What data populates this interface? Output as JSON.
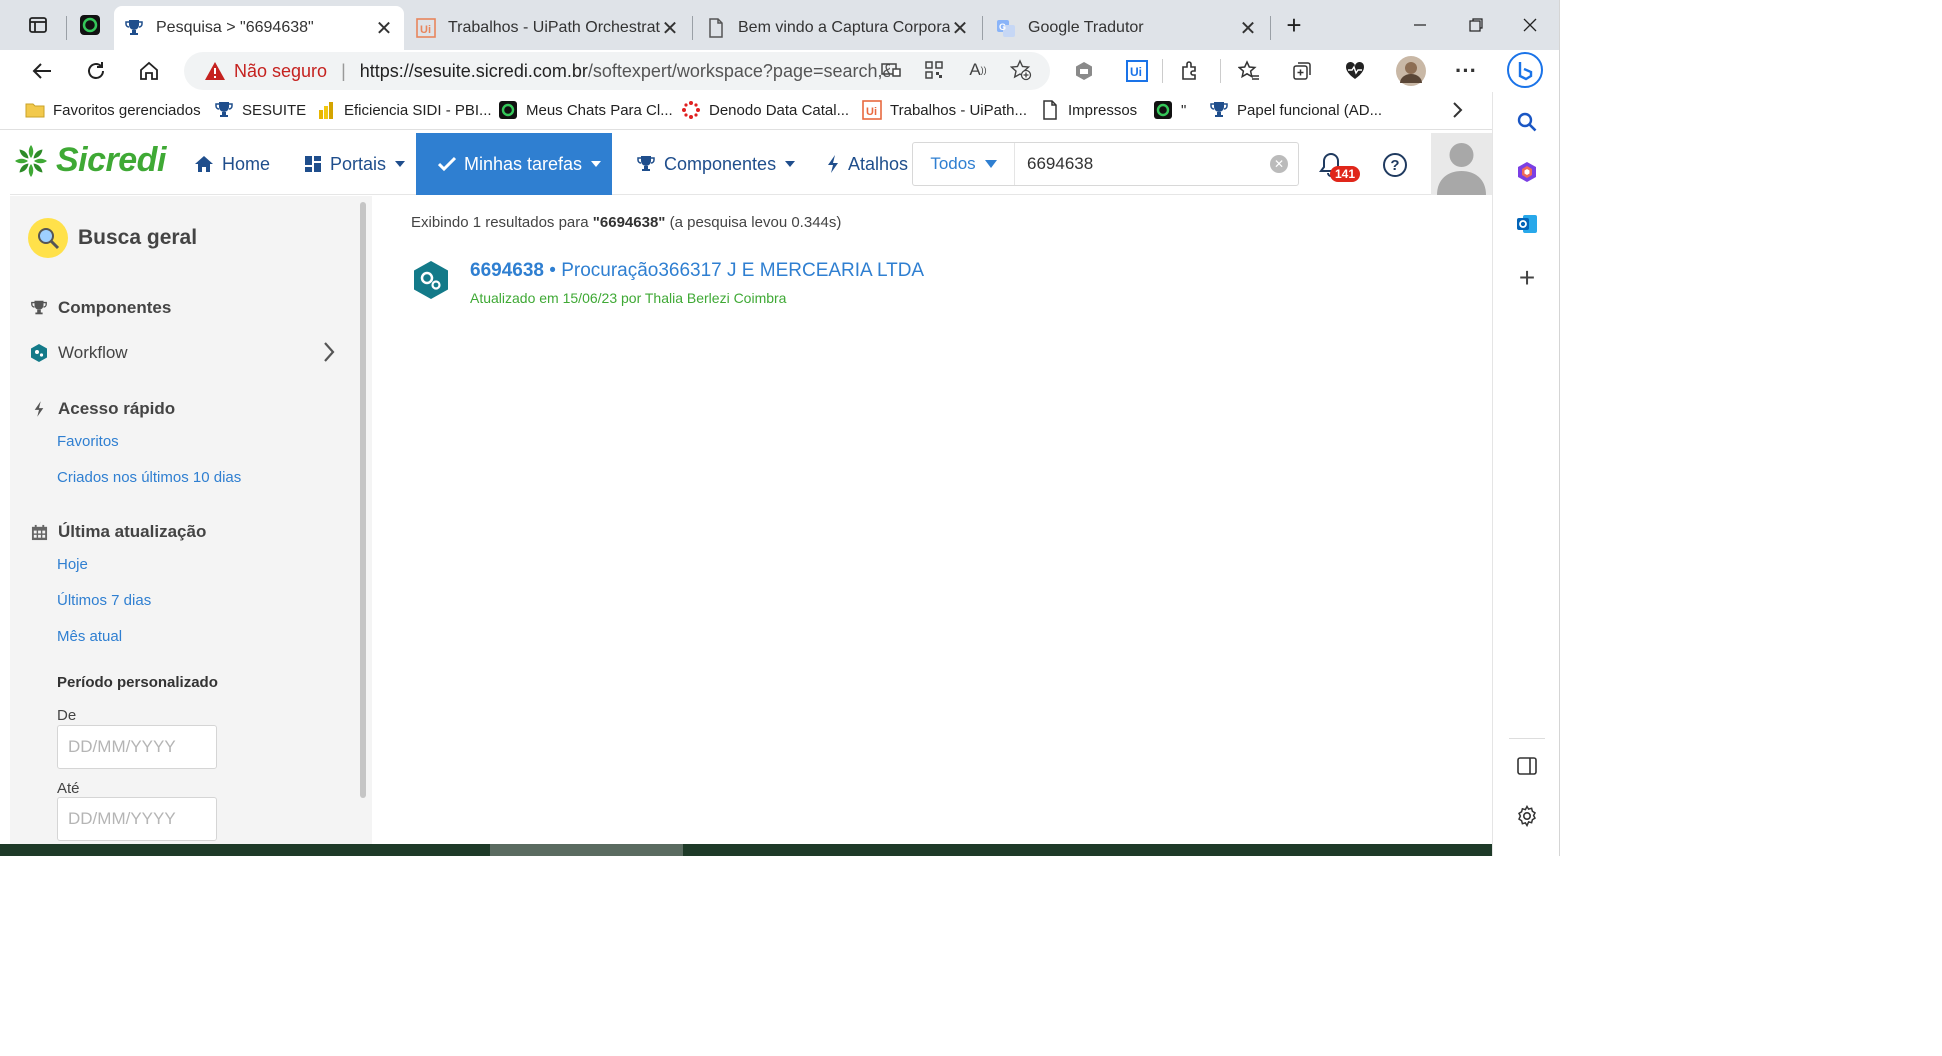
{
  "browser": {
    "tabs": [
      {
        "title": "Pesquisa > \"6694638\"",
        "icon": "trophy-icon",
        "active": true
      },
      {
        "title": "Trabalhos - UiPath Orchestrator",
        "icon": "uipath-icon",
        "active": false
      },
      {
        "title": "Bem vindo a Captura Corporativa",
        "icon": "page-icon",
        "active": false
      },
      {
        "title": "Google Tradutor",
        "icon": "google-translate-icon",
        "active": false
      }
    ],
    "address": {
      "security_label": "Não seguro",
      "url_host": "https://sesuite.sicredi.com.br",
      "url_path": "/softexpert/workspace?page=search,&..."
    },
    "bookmarks": [
      {
        "label": "Favoritos gerenciados",
        "icon": "folder-icon"
      },
      {
        "label": "SESUITE",
        "icon": "trophy-icon"
      },
      {
        "label": "Eficiencia SIDI - PBI...",
        "icon": "powerbi-icon"
      },
      {
        "label": "Meus Chats Para Cl...",
        "icon": "chat-icon"
      },
      {
        "label": "Denodo Data Catal...",
        "icon": "denodo-icon"
      },
      {
        "label": "Trabalhos - UiPath...",
        "icon": "uipath-icon"
      },
      {
        "label": "Impressos",
        "icon": "page-icon"
      },
      {
        "label": "\"",
        "icon": "chat-icon"
      },
      {
        "label": "Papel funcional (AD...",
        "icon": "trophy-icon"
      }
    ]
  },
  "app": {
    "logo": "Sicredi",
    "menu": {
      "home": "Home",
      "portais": "Portais",
      "minhas_tarefas": "Minhas tarefas",
      "componentes": "Componentes",
      "atalhos": "Atalhos"
    },
    "search": {
      "scope": "Todos",
      "value": "6694638"
    },
    "notifications_count": "141"
  },
  "sidebar": {
    "title": "Busca geral",
    "componentes_heading": "Componentes",
    "workflow_label": "Workflow",
    "acesso_rapido_heading": "Acesso rápido",
    "acesso_rapido_links": [
      "Favoritos",
      "Criados nos últimos 10 dias"
    ],
    "ultima_atualizacao_heading": "Última atualização",
    "ultima_atualizacao_links": [
      "Hoje",
      "Últimos 7 dias",
      "Mês atual"
    ],
    "periodo_heading": "Período personalizado",
    "de_label": "De",
    "ate_label": "Até",
    "date_placeholder": "DD/MM/YYYY"
  },
  "results": {
    "summary_prefix": "Exibindo 1 resultados para",
    "summary_query": "\"6694638\"",
    "summary_suffix": "(a pesquisa levou 0.344s)",
    "items": [
      {
        "id": "6694638",
        "separator": " • ",
        "title": "Procuração366317 J E MERCEARIA LTDA",
        "meta": "Atualizado em 15/06/23 por Thalia Berlezi Coimbra"
      }
    ]
  },
  "colors": {
    "primary_blue": "#2f7fd1",
    "brand_green": "#3fa935",
    "badge_red": "#e0261a",
    "active_menu_bg": "#2f7fd1"
  }
}
